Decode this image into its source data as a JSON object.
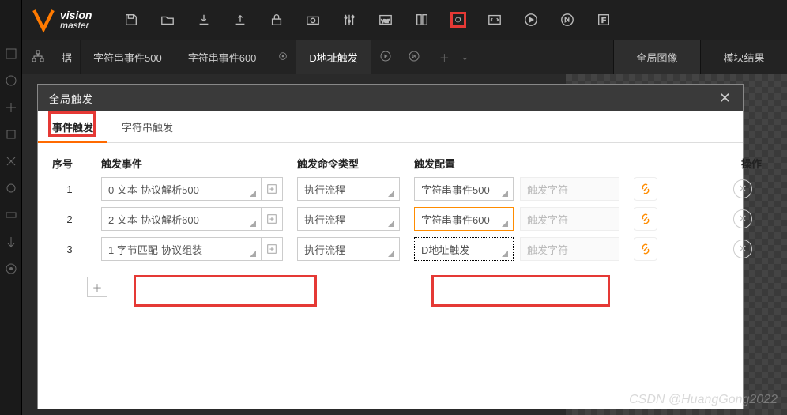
{
  "logo": {
    "line1": "vision",
    "line2": "master"
  },
  "tabs": {
    "ju": "据",
    "t1": "字符串事件500",
    "t2": "字符串事件600",
    "t3": "D地址触发"
  },
  "rtabs": {
    "global": "全局图像",
    "module": "模块结果"
  },
  "modal": {
    "title": "全局触发",
    "tab_event": "事件触发",
    "tab_string": "字符串触发",
    "headers": {
      "seq": "序号",
      "event": "触发事件",
      "cmd": "触发命令类型",
      "cfg": "触发配置",
      "op": "操作"
    },
    "rows": [
      {
        "seq": "1",
        "event": "0 文本-协议解析500",
        "cmd": "执行流程",
        "cfg": "字符串事件500",
        "chars": "触发字符"
      },
      {
        "seq": "2",
        "event": "2 文本-协议解析600",
        "cmd": "执行流程",
        "cfg": "字符串事件600",
        "chars": "触发字符"
      },
      {
        "seq": "3",
        "event": "1 字节匹配-协议组装",
        "cmd": "执行流程",
        "cfg": "D地址触发",
        "chars": "触发字符"
      }
    ]
  },
  "watermark": "CSDN @HuangGong2022"
}
